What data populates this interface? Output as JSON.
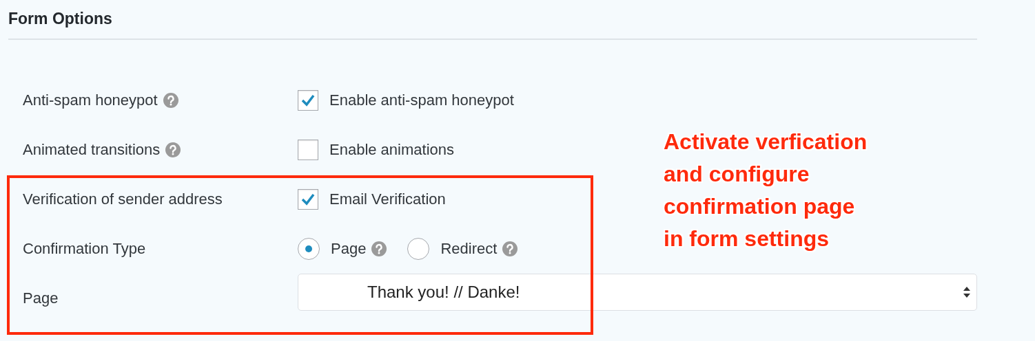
{
  "heading": "Form Options",
  "rows": [
    {
      "kind": "checkbox",
      "label": "Anti-spam honeypot",
      "help": true,
      "option": {
        "label": "Enable anti-spam honeypot",
        "checked": true
      }
    },
    {
      "kind": "checkbox",
      "label": "Animated transitions",
      "help": true,
      "option": {
        "label": "Enable animations",
        "checked": false
      }
    },
    {
      "kind": "checkbox",
      "label": "Verification of sender address",
      "help": false,
      "option": {
        "label": "Email Verification",
        "checked": true
      }
    },
    {
      "kind": "radio",
      "label": "Confirmation Type",
      "help": false,
      "options": [
        {
          "label": "Page",
          "selected": true,
          "help": true
        },
        {
          "label": "Redirect",
          "selected": false,
          "help": true
        }
      ]
    },
    {
      "kind": "select",
      "label": "Page",
      "help": false,
      "value": "Thank you! // Danke!"
    }
  ],
  "annotation": {
    "text": "Activate verfication\nand configure\nconfirmation page\nin form settings",
    "color": "#fe2a0c"
  }
}
